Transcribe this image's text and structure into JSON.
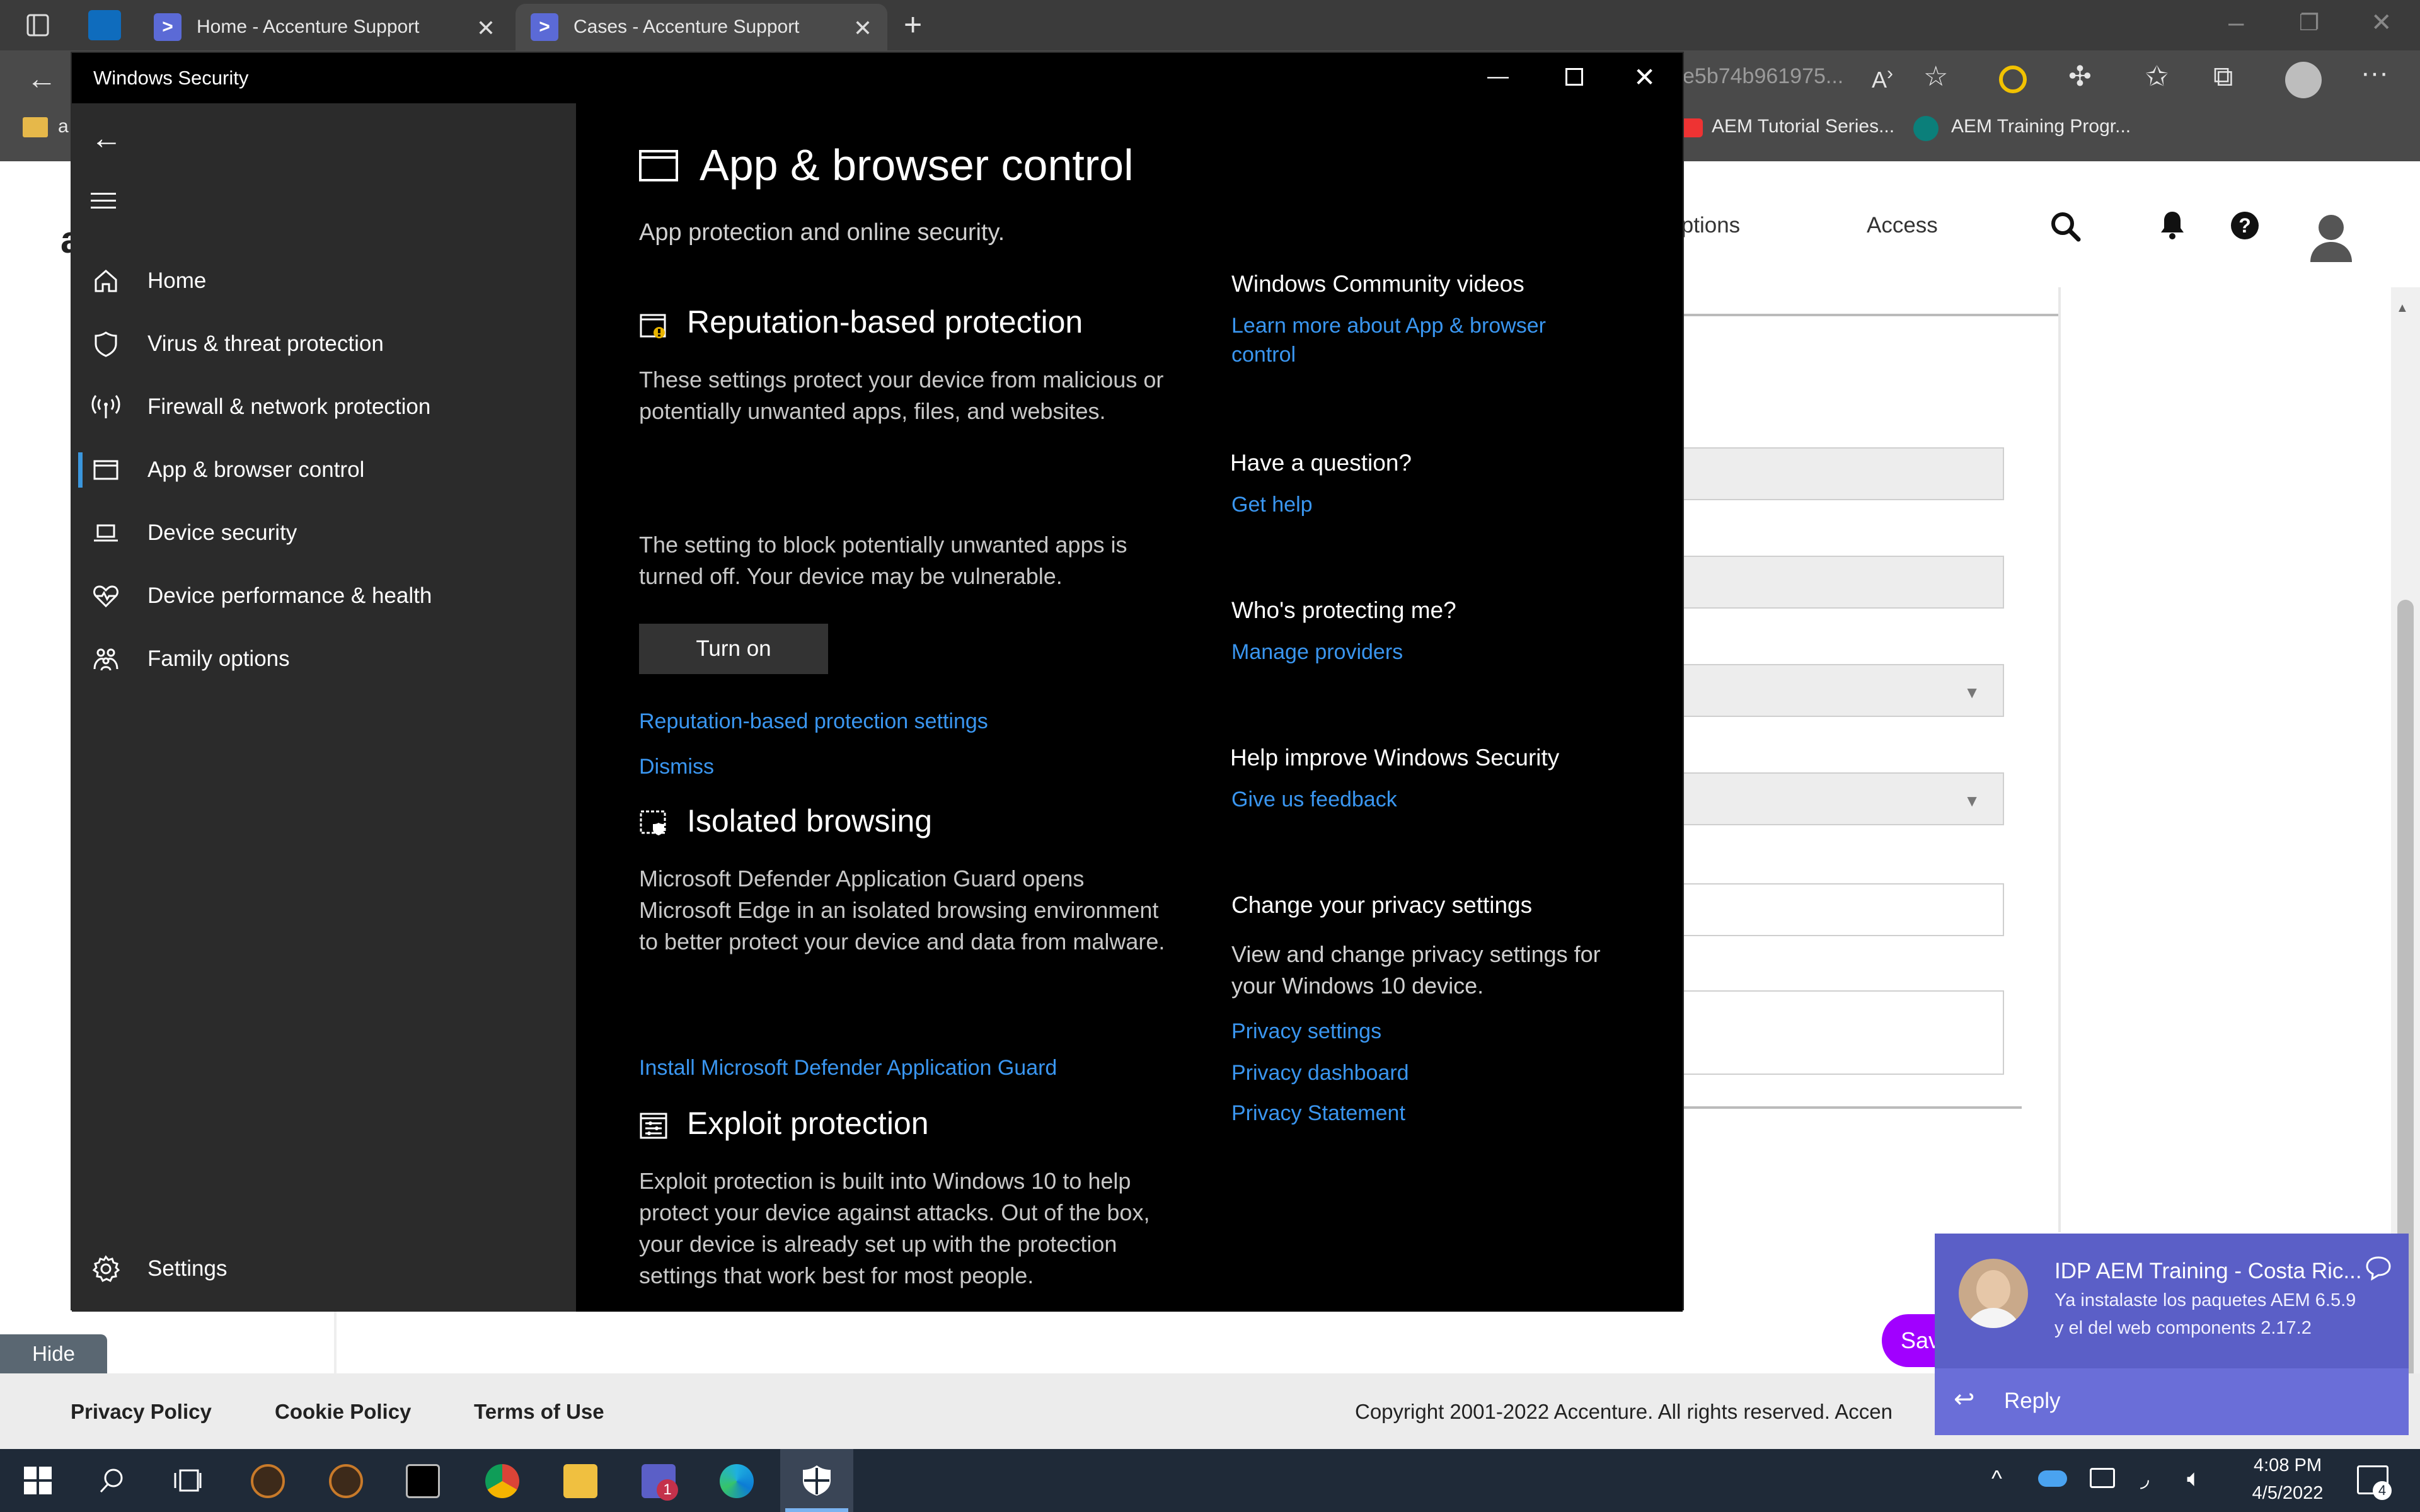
{
  "browser": {
    "tabs": [
      {
        "label": "Home - Accenture Support"
      },
      {
        "label": "Cases - Accenture Support"
      }
    ],
    "address_fragment": "e5b74b961975...",
    "favorites": [
      {
        "label": "AEM Tutorial Series..."
      },
      {
        "label": "AEM Training Progr..."
      }
    ],
    "favorites_truncated_left": "a",
    "icons": {
      "back": "back-arrow-icon",
      "new_tab": "plus-icon",
      "read_aloud": "read-aloud-icon",
      "favorite_add": "star-add-icon",
      "extensions": "puzzle-icon",
      "favorites": "favorites-icon",
      "collections": "collections-icon",
      "profile": "profile-icon",
      "more": "more-icon"
    }
  },
  "webpage": {
    "nav": {
      "partial_item": "iptions",
      "access": "Access",
      "left_fragment": "a"
    },
    "save_button_partial": "Sav",
    "hide_button": "Hide",
    "footer": {
      "privacy": "Privacy Policy",
      "cookie": "Cookie Policy",
      "terms": "Terms of Use",
      "copyright": "Copyright 2001-2022 Accenture. All rights reserved. Accen"
    }
  },
  "security": {
    "window_title": "Windows Security",
    "sidebar": {
      "items": [
        {
          "label": "Home",
          "icon": "home-icon"
        },
        {
          "label": "Virus & threat protection",
          "icon": "shield-icon"
        },
        {
          "label": "Firewall & network protection",
          "icon": "antenna-icon"
        },
        {
          "label": "App & browser control",
          "icon": "app-window-icon",
          "selected": true
        },
        {
          "label": "Device security",
          "icon": "laptop-icon"
        },
        {
          "label": "Device performance & health",
          "icon": "heart-icon"
        },
        {
          "label": "Family options",
          "icon": "family-icon"
        }
      ],
      "settings": "Settings"
    },
    "page": {
      "title": "App & browser control",
      "subtitle": "App protection and online security.",
      "reputation": {
        "heading": "Reputation-based protection",
        "desc": "These settings protect your device from malicious or potentially unwanted apps, files, and websites.",
        "warning": "The setting to block potentially unwanted apps is turned off. Your device may be vulnerable.",
        "button": "Turn on",
        "settings_link": "Reputation-based protection settings",
        "dismiss_link": "Dismiss"
      },
      "isolated": {
        "heading": "Isolated browsing",
        "desc": "Microsoft Defender Application Guard opens Microsoft Edge in an isolated browsing environment to better protect your device and data from malware.",
        "link": "Install Microsoft Defender Application Guard"
      },
      "exploit": {
        "heading": "Exploit protection",
        "desc": "Exploit protection is built into Windows 10 to help protect your device against attacks.  Out of the box, your device is already set up with the protection settings that work best for most people."
      }
    },
    "side": {
      "community": {
        "heading": "Windows Community videos",
        "link": "Learn more about App & browser control"
      },
      "question": {
        "heading": "Have a question?",
        "link": "Get help"
      },
      "protecting": {
        "heading": "Who's protecting me?",
        "link": "Manage providers"
      },
      "improve": {
        "heading": "Help improve Windows Security",
        "link": "Give us feedback"
      },
      "privacy": {
        "heading": "Change your privacy settings",
        "desc": "View and change privacy settings for your Windows 10 device.",
        "links": [
          "Privacy settings",
          "Privacy dashboard",
          "Privacy Statement"
        ]
      }
    }
  },
  "toast": {
    "title": "IDP AEM Training - Costa Ric...",
    "line1": "Ya instalaste los paquetes AEM 6.5.9",
    "line2": "y el del web components 2.17.2",
    "reply": "Reply"
  },
  "taskbar": {
    "time": "4:08 PM",
    "date": "4/5/2022",
    "notification_count": "4",
    "teams_badge": "1"
  },
  "colors": {
    "link": "#3a96f0",
    "sidebar_bg": "#2b2b2b",
    "content_bg": "#000000",
    "toast_bg": "#5b5fc7"
  }
}
